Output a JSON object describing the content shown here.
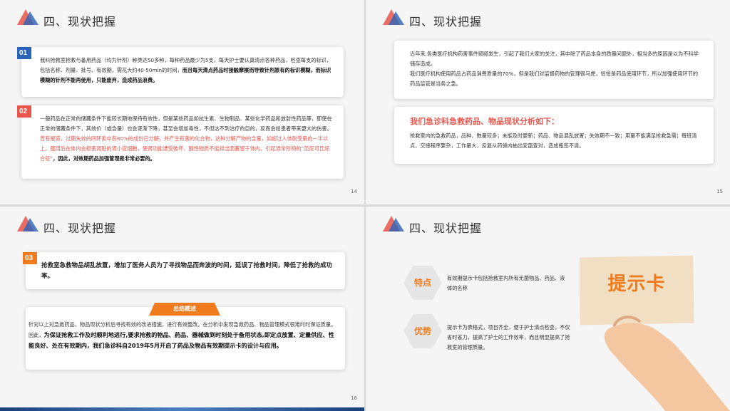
{
  "colors": {
    "accent_orange": "#f07b1d",
    "accent_red": "#e8554a",
    "accent_blue": "#2a63b8",
    "text": "#333333"
  },
  "slides": [
    {
      "page": "14",
      "title": "四、现状把握",
      "item1": {
        "num": "01",
        "text": "我科抢救室抢救与备用药品（均为针剂）种类达50多种，每种药品最少为5支，每天护士要认真清点各种药品，检查每支的标识，包括名称、剂量、批号、有效期，需花大约40-50min的时间，",
        "bold": "而且每天清点药品时接触摩擦而导致针剂原有的标识模糊，而标识模糊的针剂不能再使用，只能废弃，造成药品浪费。"
      },
      "item2": {
        "num": "02",
        "text": "一般药品在正常的储藏条件下能较长期地保持有效性，但是某些药品如抗生素、生物制品、某些化学药品和放射性药品等，即使在正常的储藏条件下，其效价（或含量）也会逐渐下降，甚至会增加毒性，不但达不到治疗的目的，反而会给患者带来更大的伤害。",
        "red": "曾有报道，过期失效的四环素中有80%的成份已分解，并产生有害的化合物，这种分解产物的含量，如超过人体耐受量的一半以上，服用后在体内会损害肾脏的肾小管细胞，使肾功能遭受破坏，酸性物质不能排出而蓄留于体内，引起通常所称的“范尼可氏综合征”",
        "bold_prefix": "，因此，对效期药品加强管理是非常必要的。"
      }
    },
    {
      "page": "15",
      "title": "四、现状把握",
      "para1": "近年来,各类医疗机构药害事件频频发生，引起了我们大家的关注，其中除了药品本身的质量问题外，相当多的原因是以为不科学储存造成。",
      "para2": "我们医疗机构使用药品占药品消费质量的70%，但是我们对监督药物的管理很马虎，恰恰是药品使用环节，所以加强使用环节的药品监管是当务之急。",
      "analysis_title": "我们急诊科急救药品、物品现状分析如下：",
      "analysis_text": "抢救室内的急救药品，品种、数量较多；未能及时更新；药品、物品混乱放置；失效期不一致；用量不能满足抢救急需；每班清点、交接程序繁杂，工作量大，反复从药袋内抽出安瓿查对，造成瓶签不清。"
    },
    {
      "page": "16",
      "title": "四、现状把握",
      "item3": {
        "num": "03",
        "text": "抢救室急救物品胡乱放置，增加了医务人员为了寻找物品而奔波的时间，延误了抢救时间，降低了抢救的成功率。"
      },
      "summary_tab": "总结概述",
      "summary_text": "针对以上对急救药品、物品现状分析后寻找有效的改进措施，进行有效整改。在分析中发现急救药品、物品管理模式很难时时保证质量。因此，",
      "summary_bold": "为保证抢救工作及时顺利地进行,要求抢救的物品、药品、器械做到时刻处于备用状态,即定点放置、定量供应、性能良好、处在有效期内，我们急诊科自2019年5月开启了药品及物品有效期提示卡的设计与应用。"
    },
    {
      "page": "17",
      "title": "四、现状把握",
      "feature_label": "特点",
      "feature_text": "有效期提示卡包括抢救室内所有无菌物品、药品、液体的名称",
      "advantage_label": "优势",
      "advantage_text": "提示卡为表格式，项目齐全，便于护士清点检查，不仅省时省力，提高了护士的工作效率，而且明显提高了抢救室的管理质量。",
      "card_text": "提示卡"
    }
  ]
}
